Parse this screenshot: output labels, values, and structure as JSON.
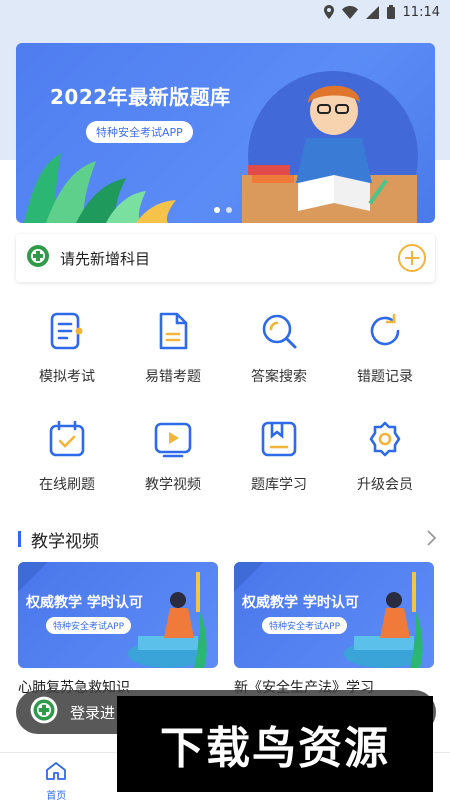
{
  "status_bar": {
    "time": "11:14"
  },
  "banner": {
    "title": "2022年最新版题库",
    "pill": "特种安全考试APP",
    "accent": "#4f7df0"
  },
  "add_subject": {
    "label": "请先新增科目"
  },
  "features_row1": [
    {
      "label": "模拟考试",
      "icon": "exam-list-icon"
    },
    {
      "label": "易错考题",
      "icon": "document-icon"
    },
    {
      "label": "答案搜索",
      "icon": "search-icon"
    },
    {
      "label": "错题记录",
      "icon": "refresh-icon"
    }
  ],
  "features_row2": [
    {
      "label": "在线刷题",
      "icon": "calendar-check-icon"
    },
    {
      "label": "教学视频",
      "icon": "video-play-icon"
    },
    {
      "label": "题库学习",
      "icon": "bookmark-icon"
    },
    {
      "label": "升级会员",
      "icon": "gear-icon"
    }
  ],
  "section": {
    "title": "教学视频"
  },
  "videos": [
    {
      "banner_title": "权威教学 学时认可",
      "banner_pill": "特种安全考试APP",
      "caption": "心肺复苏急救知识"
    },
    {
      "banner_title": "权威教学 学时认可",
      "banner_pill": "特种安全考试APP",
      "caption": "新《安全生产法》学习"
    }
  ],
  "toast": {
    "text": "登录进"
  },
  "tabbar": {
    "tabs": [
      {
        "label": "首页",
        "active": true
      },
      {
        "label": "",
        "active": false
      },
      {
        "label": "",
        "active": false
      },
      {
        "label": "",
        "active": false
      }
    ]
  },
  "watermark": {
    "text": "下载鸟资源"
  },
  "colors": {
    "primary": "#2f6ae8",
    "icon_yellow": "#f2b53b",
    "green": "#2e9a4a"
  }
}
